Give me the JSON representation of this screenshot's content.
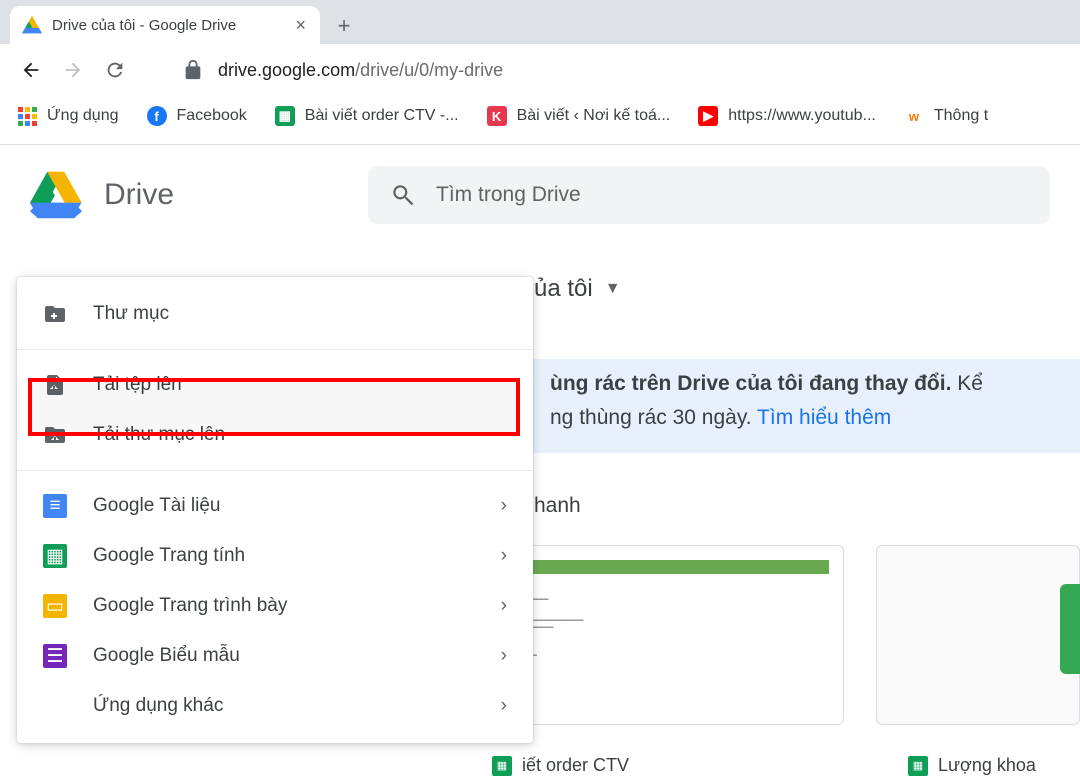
{
  "browser": {
    "tab_title": "Drive của tôi - Google Drive",
    "url_host": "drive.google.com",
    "url_path": "/drive/u/0/my-drive"
  },
  "bookmarks": {
    "apps": "Ứng dụng",
    "facebook": "Facebook",
    "order": "Bài viết order CTV -...",
    "blog": "Bài viết ‹ Nơi kế toá...",
    "youtube": "https://www.youtub...",
    "thong": "Thông t"
  },
  "drive": {
    "title": "Drive",
    "search_placeholder": "Tìm trong Drive",
    "breadcrumb": "ủa tôi",
    "section": "hanh"
  },
  "banner": {
    "text1": "ùng rác trên Drive của tôi đang thay đổi.",
    "text2_prefix": " Kể",
    "text3": "ng thùng rác 30 ngày. ",
    "link": "Tìm hiểu thêm"
  },
  "menu": {
    "folder": "Thư mục",
    "file_upload": "Tải tệp lên",
    "folder_upload": "Tải thư mục lên",
    "docs": "Google Tài liệu",
    "sheets": "Google Trang tính",
    "slides": "Google Trang trình bày",
    "forms": "Google Biểu mẫu",
    "more": "Ứng dụng khác"
  },
  "files": {
    "f1": "iết order CTV",
    "f2": "Lượng khoa"
  }
}
